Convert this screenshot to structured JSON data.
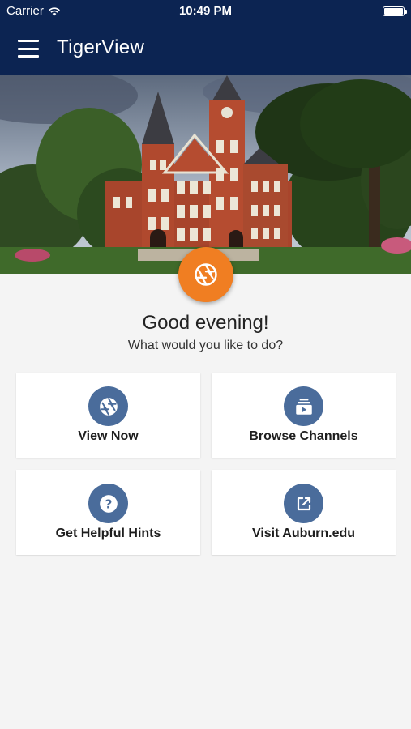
{
  "status_bar": {
    "carrier": "Carrier",
    "time": "10:49 PM",
    "wifi_icon": "wifi-icon",
    "battery_icon": "battery-icon"
  },
  "app_bar": {
    "title": "TigerView",
    "menu_icon": "hamburger-menu-icon"
  },
  "hero": {
    "image": "campus building photo"
  },
  "fab": {
    "icon": "camera-shutter-icon",
    "color": "#f07e22"
  },
  "greeting": {
    "title": "Good evening!",
    "subtitle": "What would you like to do?"
  },
  "actions": [
    {
      "label": "View Now",
      "icon": "camera-shutter-icon"
    },
    {
      "label": "Browse Channels",
      "icon": "channels-icon"
    },
    {
      "label": "Get Helpful Hints",
      "icon": "help-icon"
    },
    {
      "label": "Visit Auburn.edu",
      "icon": "external-link-icon"
    }
  ],
  "colors": {
    "header": "#0c2452",
    "accent": "#f07e22",
    "icon_circle": "#4a6c9b",
    "background": "#f4f4f4"
  }
}
